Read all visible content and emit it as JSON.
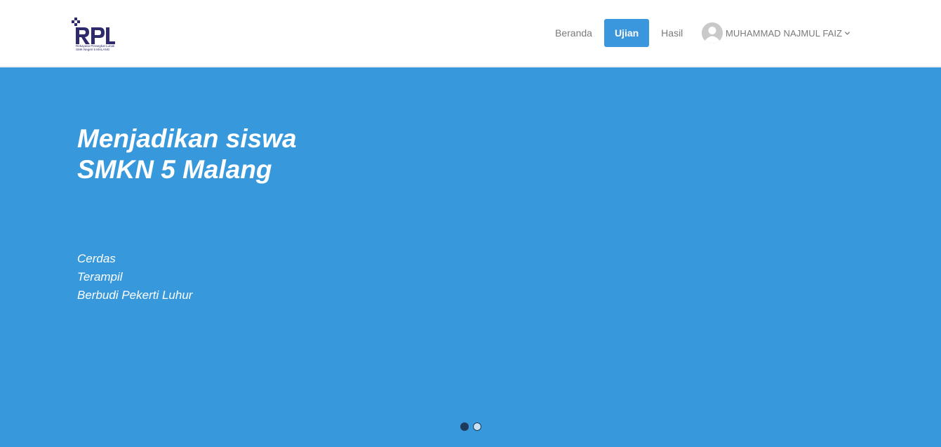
{
  "logo": {
    "alt": "RPL logo",
    "text": "RPL",
    "subtitle1": "Rekayasa Perangkat Lunak",
    "subtitle2": "SMK Negeri 5 MALANG"
  },
  "nav": {
    "items": [
      {
        "label": "Beranda",
        "active": false
      },
      {
        "label": "Ujian",
        "active": true
      },
      {
        "label": "Hasil",
        "active": false
      }
    ]
  },
  "user": {
    "name": "MUHAMMAD NAJMUL FAIZ",
    "avatar_icon": "user-avatar-icon",
    "dropdown_icon": "chevron-down-icon"
  },
  "hero": {
    "title_line1": "Menjadikan siswa",
    "title_line2": "SMKN 5 Malang",
    "items": [
      "Cerdas",
      "Terampil",
      "Berbudi Pekerti Luhur"
    ]
  },
  "carousel": {
    "slides": 2,
    "active_index": 0
  },
  "colors": {
    "hero_bg": "#3798db",
    "active_nav_bg": "#3b97dd",
    "logo_color": "#2e2a6b"
  }
}
